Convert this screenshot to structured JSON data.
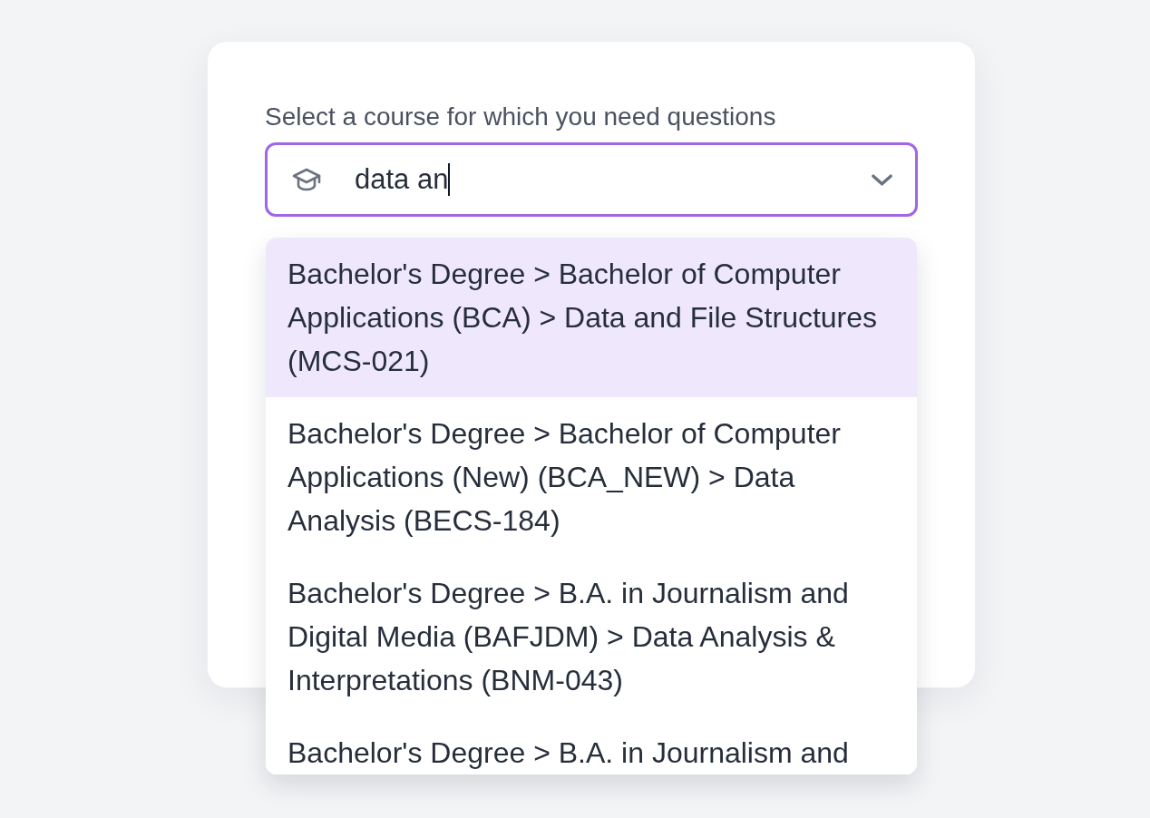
{
  "course_select": {
    "label": "Select a course for which you need questions",
    "value": "data an",
    "focused": true,
    "expanded": true,
    "options": [
      {
        "text": "Bachelor's Degree > Bachelor of Computer Applications (BCA) > Data and File Structures (MCS-021)",
        "selected": true
      },
      {
        "text": "Bachelor's Degree > Bachelor of Computer Applications (New) (BCA_NEW) > Data Analysis (BECS-184)",
        "selected": false
      },
      {
        "text": "Bachelor's Degree > B.A. in Journalism and Digital Media (BAFJDM) > Data Analysis & Interpretations (BNM-043)",
        "selected": false
      },
      {
        "text": "Bachelor's Degree > B.A. in Journalism and",
        "selected": false
      }
    ]
  }
}
